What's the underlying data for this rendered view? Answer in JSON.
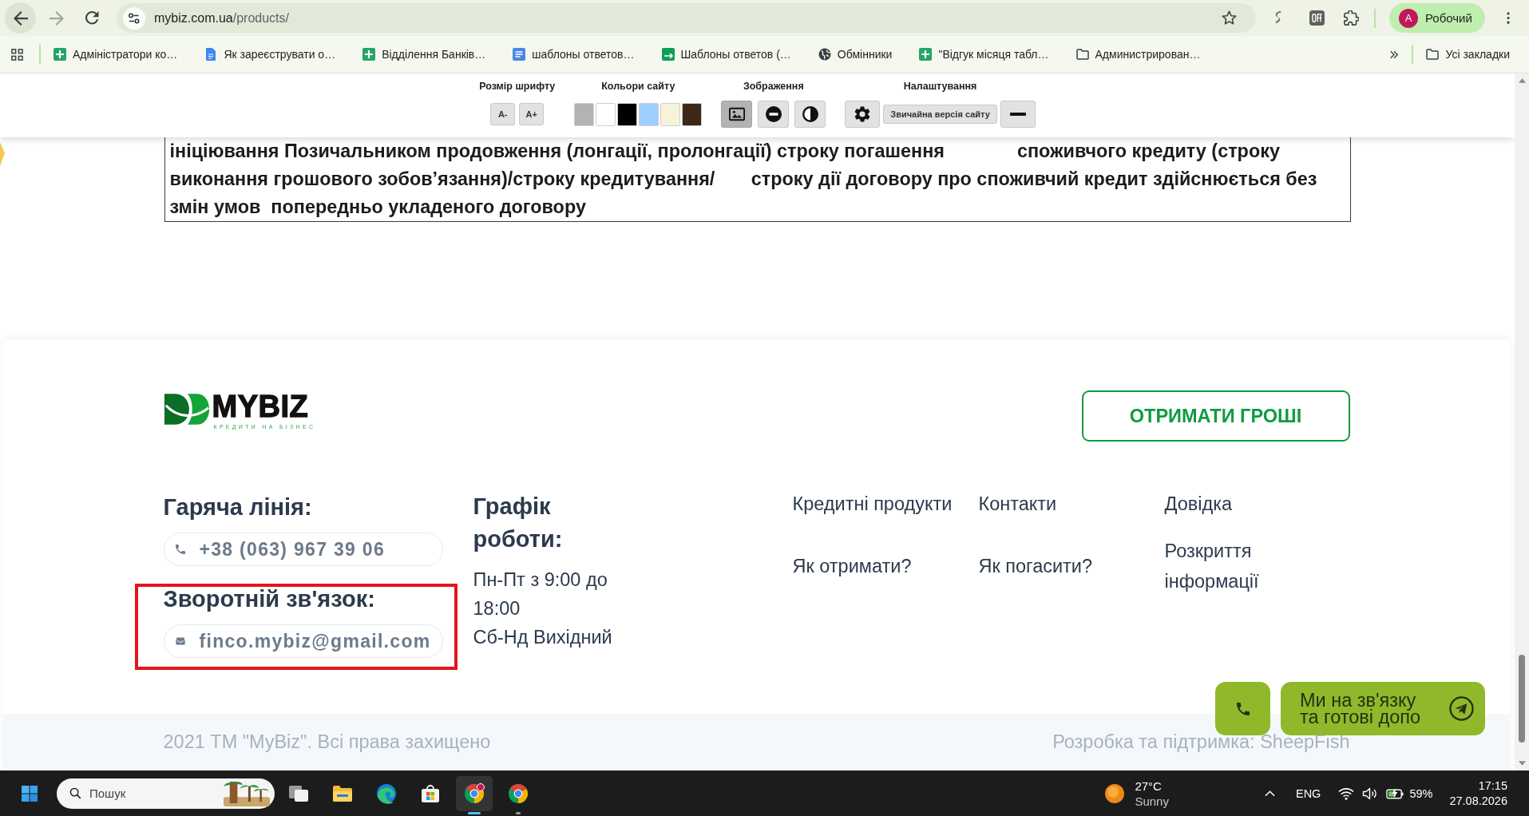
{
  "browser": {
    "forward_disabled": true,
    "url": {
      "host": "mybiz.com.ua",
      "path": "/products/"
    },
    "bookmarked": false,
    "profile": {
      "initial": "A",
      "name": "Робочий"
    }
  },
  "bookmarks": {
    "items": [
      {
        "kind": "sheet",
        "label": "Адміністратори ко…"
      },
      {
        "kind": "doc-page",
        "label": "Як зареєструвати о…"
      },
      {
        "kind": "sheet",
        "label": "Відділення Банків…"
      },
      {
        "kind": "doc",
        "label": "шаблоны ответов…"
      },
      {
        "kind": "form",
        "label": "Шаблоны ответов (…"
      },
      {
        "kind": "globe",
        "label": "Обмінники"
      },
      {
        "kind": "sheet",
        "label": "\"Відгук місяця табл…"
      },
      {
        "kind": "folder",
        "label": "Администрирован…"
      }
    ],
    "all_label": "Усі закладки"
  },
  "accessibility_panel": {
    "font_size": {
      "title": "Розмір шрифту",
      "buttons": [
        "A-",
        "A+"
      ]
    },
    "site_colors": {
      "title": "Кольори сайту",
      "swatches": [
        {
          "color": "#b3b3b3",
          "selected": false
        },
        {
          "color": "#ffffff",
          "selected": false
        },
        {
          "color": "#000000",
          "selected": false
        },
        {
          "color": "#9ed0ff",
          "selected": false
        },
        {
          "color": "#f7f3d9",
          "selected": false
        },
        {
          "color": "#3d2716",
          "selected": false
        }
      ]
    },
    "images": {
      "title": "Зображення",
      "modes": [
        {
          "selected": true
        },
        {
          "selected": false
        },
        {
          "selected": false
        }
      ]
    },
    "settings": {
      "title": "Налаштування",
      "normal_version": "Звичайна версія сайту"
    }
  },
  "article": {
    "lines": [
      "ініціювання Позичальником продовження (лонгації, пролонгації) строку погашення              споживчого кредиту (строку",
      "виконання грошового зобов’язання)/строку кредитування/       строку дії договору про споживчий кредит здійснюється без",
      "змін умов  попередньо укладеного договору"
    ]
  },
  "footer": {
    "logo": {
      "name": "MYBIZ",
      "tagline": "КРЕДИТИ НА БІЗНЕС"
    },
    "cta": "ОТРИМАТИ ГРОШІ",
    "contacts": [
      {
        "kind": "phone",
        "title": "Гаряча лінія:",
        "value": "+38 (063) 967 39 06",
        "highlighted": false
      },
      {
        "kind": "email",
        "title": "Зворотній зв'язок:",
        "value": "finco.mybiz@gmail.com",
        "highlighted": true
      }
    ],
    "schedule": {
      "title": "Графік роботи:",
      "lines": [
        "Пн-Пт з 9:00 до 18:00",
        "Сб-Нд Вихідний"
      ]
    },
    "links": [
      "Кредитні продукти",
      "Контакти",
      "Довідка",
      "Як отримати?",
      "Як погасити?",
      "Розкриття інформації"
    ],
    "copyright": "2021 ТМ \"MyBiz\". Всі права захищено",
    "developer": "Розробка та підтримка: SheepFish"
  },
  "chat_widget": {
    "lines": [
      "Ми на зв'язку",
      "та готові допо"
    ]
  },
  "taskbar": {
    "search": {
      "placeholder": "Пошук"
    },
    "apps": [
      {
        "kind": "task-view",
        "running": false,
        "selected": false
      },
      {
        "kind": "explorer",
        "running": false,
        "selected": false
      },
      {
        "kind": "edge",
        "running": false,
        "selected": false
      },
      {
        "kind": "store",
        "running": false,
        "selected": false
      },
      {
        "kind": "chrome-profile",
        "running": true,
        "selected": true
      },
      {
        "kind": "chrome",
        "running": true,
        "selected": false
      }
    ],
    "weather": {
      "temperature": "27°C",
      "condition": "Sunny"
    },
    "language": "ENG",
    "battery": "59%",
    "time": "17:15",
    "date": "27.08.2026"
  }
}
